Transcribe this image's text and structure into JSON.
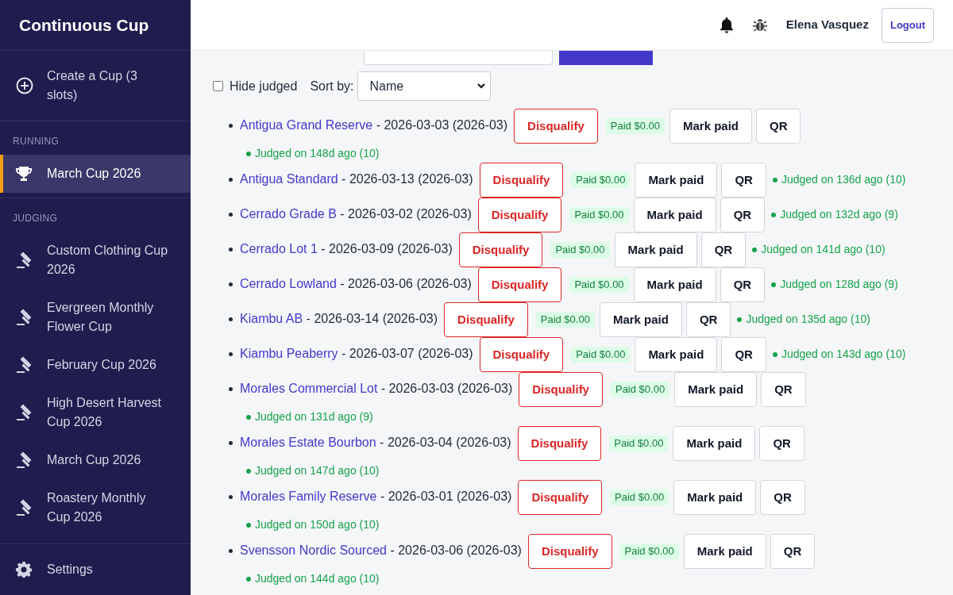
{
  "sidebar": {
    "title": "Continuous Cup",
    "create": {
      "label": "Create a Cup (3 slots)"
    },
    "sections": [
      {
        "kind": "running",
        "label": "RUNNING",
        "items": [
          {
            "label": "March Cup 2026",
            "selected": true
          }
        ]
      },
      {
        "kind": "judging",
        "label": "JUDGING",
        "items": [
          {
            "label": "Custom Clothing Cup 2026",
            "selected": false
          },
          {
            "label": "Evergreen Monthly Flower Cup",
            "selected": false
          },
          {
            "label": "February Cup 2026",
            "selected": false
          },
          {
            "label": "High Desert Harvest Cup 2026",
            "selected": false
          },
          {
            "label": "March Cup 2026",
            "selected": false
          },
          {
            "label": "Roastery Monthly Cup 2026",
            "selected": false
          }
        ]
      }
    ],
    "settings": {
      "label": "Settings"
    }
  },
  "header": {
    "user": "Elena Vasquez",
    "logout": "Logout"
  },
  "filters": {
    "hide_judged": {
      "label": "Hide judged",
      "checked": false
    },
    "sort_label": "Sort by:",
    "sort_value": "Name"
  },
  "entries": [
    {
      "name": "Antigua Grand Reserve",
      "detail": "- 2026-03-03 (2026-03)",
      "disqualify": "Disqualify",
      "paid": "Paid $0.00",
      "mark_paid": "Mark paid",
      "qr": "QR",
      "judged": "Judged on 148d ago (10)"
    },
    {
      "name": "Antigua Standard",
      "detail": "- 2026-03-13 (2026-03)",
      "disqualify": "Disqualify",
      "paid": "Paid $0.00",
      "mark_paid": "Mark paid",
      "qr": "QR",
      "judged": "Judged on 136d ago (10)"
    },
    {
      "name": "Cerrado Grade B",
      "detail": "- 2026-03-02 (2026-03)",
      "disqualify": "Disqualify",
      "paid": "Paid $0.00",
      "mark_paid": "Mark paid",
      "qr": "QR",
      "judged": "Judged on 132d ago (9)"
    },
    {
      "name": "Cerrado Lot 1",
      "detail": "- 2026-03-09 (2026-03)",
      "disqualify": "Disqualify",
      "paid": "Paid $0.00",
      "mark_paid": "Mark paid",
      "qr": "QR",
      "judged": "Judged on 141d ago (10)"
    },
    {
      "name": "Cerrado Lowland",
      "detail": "- 2026-03-06 (2026-03)",
      "disqualify": "Disqualify",
      "paid": "Paid $0.00",
      "mark_paid": "Mark paid",
      "qr": "QR",
      "judged": "Judged on 128d ago (9)"
    },
    {
      "name": "Kiambu AB",
      "detail": "- 2026-03-14 (2026-03)",
      "disqualify": "Disqualify",
      "paid": "Paid $0.00",
      "mark_paid": "Mark paid",
      "qr": "QR",
      "judged": "Judged on 135d ago (10)"
    },
    {
      "name": "Kiambu Peaberry",
      "detail": "- 2026-03-07 (2026-03)",
      "disqualify": "Disqualify",
      "paid": "Paid $0.00",
      "mark_paid": "Mark paid",
      "qr": "QR",
      "judged": "Judged on 143d ago (10)"
    },
    {
      "name": "Morales Commercial Lot",
      "detail": "- 2026-03-03 (2026-03)",
      "disqualify": "Disqualify",
      "paid": "Paid $0.00",
      "mark_paid": "Mark paid",
      "qr": "QR",
      "judged": "Judged on 131d ago (9)"
    },
    {
      "name": "Morales Estate Bourbon",
      "detail": "- 2026-03-04 (2026-03)",
      "disqualify": "Disqualify",
      "paid": "Paid $0.00",
      "mark_paid": "Mark paid",
      "qr": "QR",
      "judged": "Judged on 147d ago (10)"
    },
    {
      "name": "Morales Family Reserve",
      "detail": "- 2026-03-01 (2026-03)",
      "disqualify": "Disqualify",
      "paid": "Paid $0.00",
      "mark_paid": "Mark paid",
      "qr": "QR",
      "judged": "Judged on 150d ago (10)"
    },
    {
      "name": "Svensson Nordic Sourced",
      "detail": "- 2026-03-06 (2026-03)",
      "disqualify": "Disqualify",
      "paid": "Paid $0.00",
      "mark_paid": "Mark paid",
      "qr": "QR",
      "judged": "Judged on 144d ago (10)"
    }
  ]
}
